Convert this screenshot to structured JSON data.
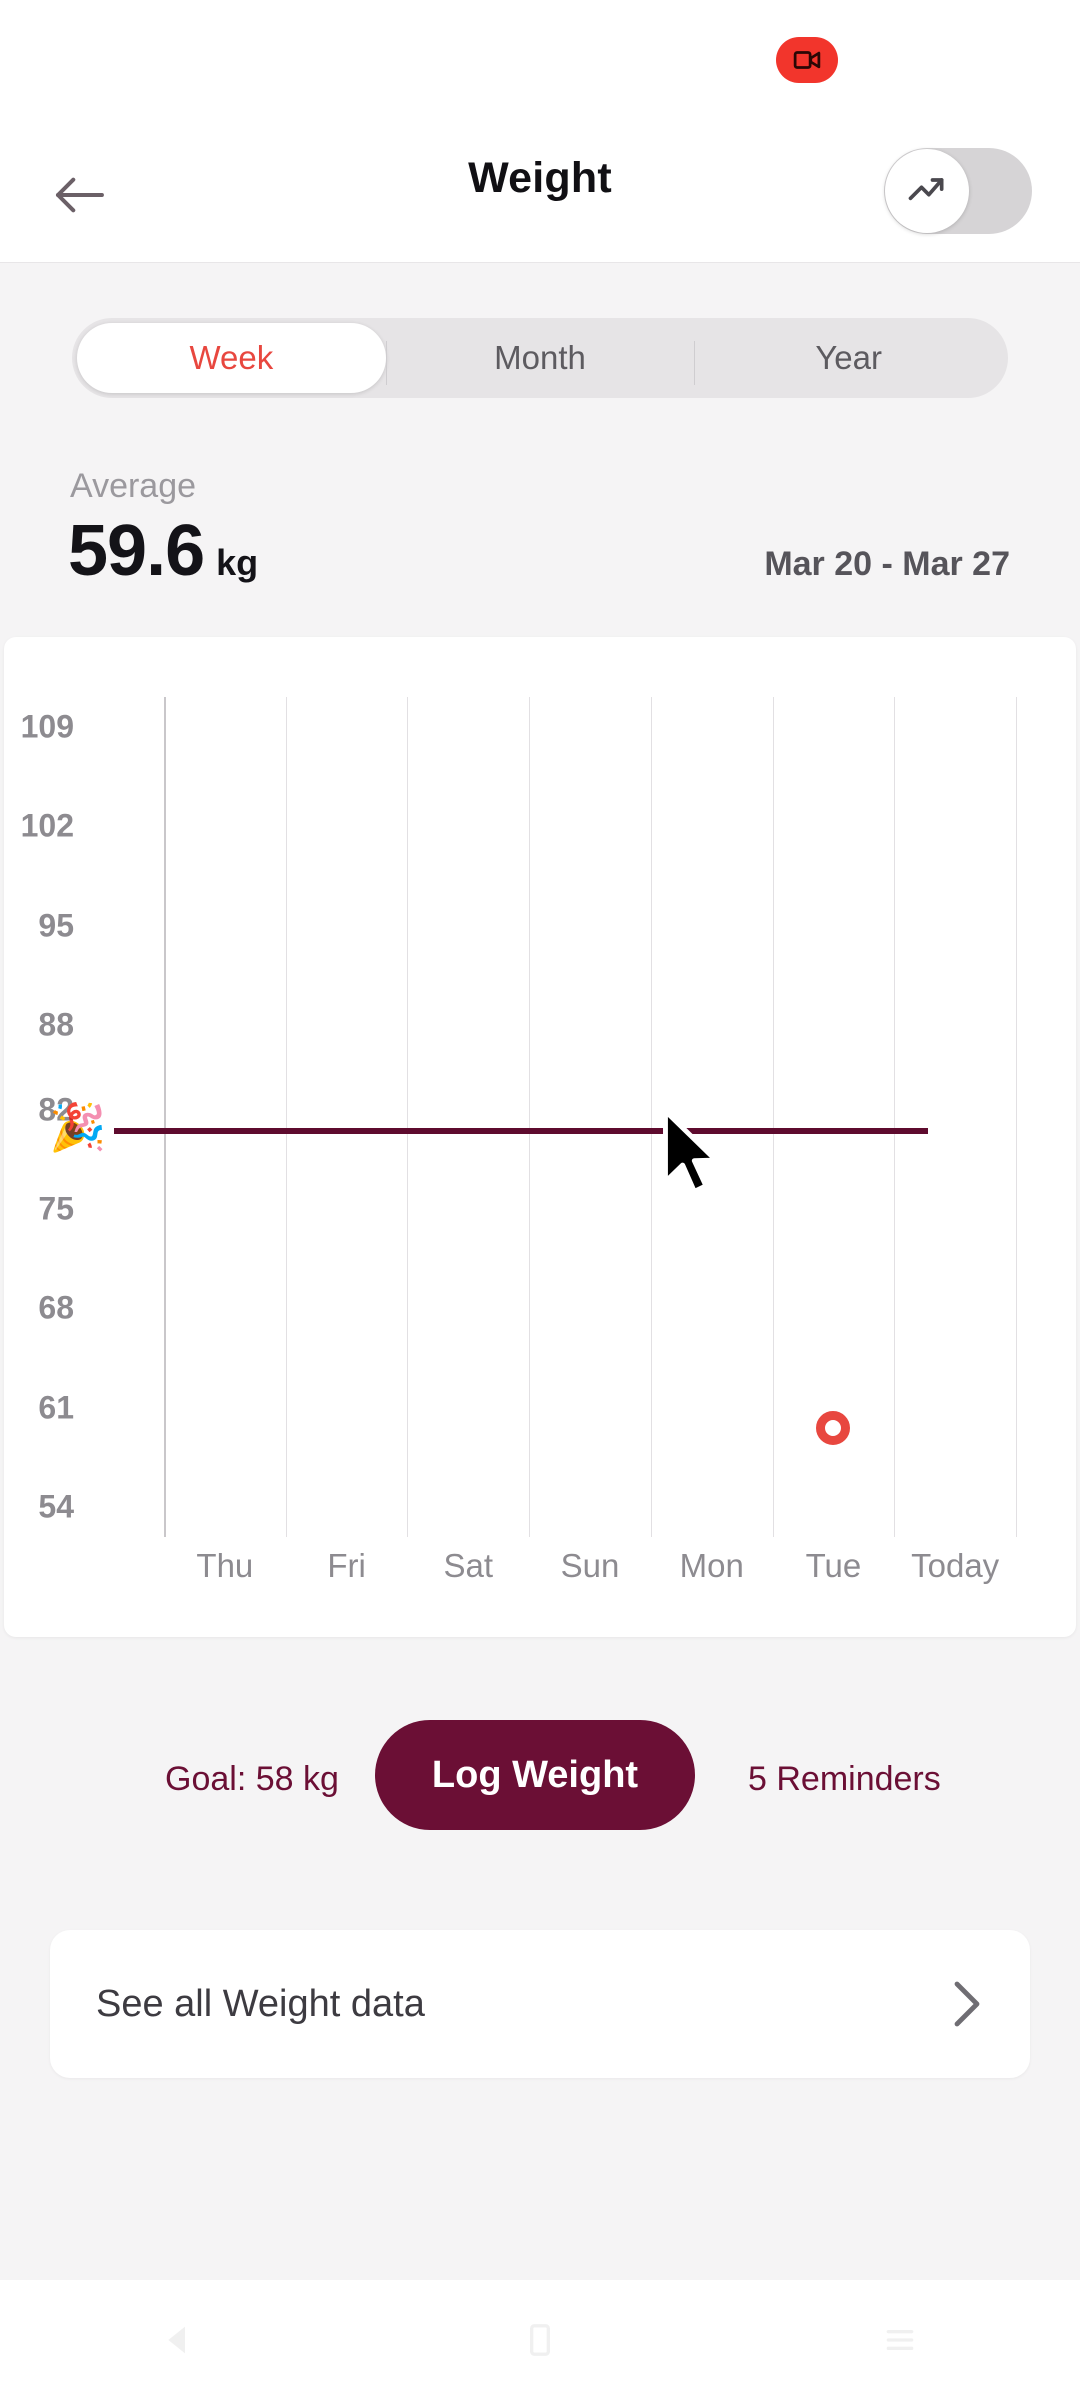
{
  "statusbar": {
    "recording_icon": "video-recording-icon",
    "recording_color": "#f2352c"
  },
  "header": {
    "title": "Weight",
    "back_icon": "arrow-left-icon",
    "toggle_icon": "trending-up-icon",
    "toggle_state": "off"
  },
  "segmented": {
    "options": [
      {
        "label": "Week",
        "active": true
      },
      {
        "label": "Month",
        "active": false
      },
      {
        "label": "Year",
        "active": false
      }
    ],
    "active_color": "#e8473f"
  },
  "summary": {
    "average_label": "Average",
    "average_value": "59.6",
    "average_unit": "kg",
    "date_range": "Mar 20 - Mar 27"
  },
  "chart_data": {
    "type": "scatter",
    "title": "",
    "xlabel": "",
    "ylabel": "",
    "categories": [
      "Thu",
      "Fri",
      "Sat",
      "Sun",
      "Mon",
      "Tue",
      "Today"
    ],
    "yticks": [
      109,
      102,
      95,
      88,
      82,
      75,
      68,
      61,
      54
    ],
    "ylim": [
      54,
      109
    ],
    "grid": true,
    "series": [
      {
        "name": "Weight",
        "color": "#e8473f",
        "points": [
          {
            "x": "Tue",
            "y": 59.6
          }
        ]
      }
    ],
    "annotations": [
      {
        "type": "hline",
        "name": "goal-line",
        "value": 82,
        "color": "#5e0b2e",
        "emoji": "🎉"
      }
    ]
  },
  "actions": {
    "goal_text": "Goal: 58 kg",
    "log_button": "Log Weight",
    "reminders_text": "5 Reminders",
    "accent_color": "#6b0f35"
  },
  "seeall": {
    "label": "See all Weight data",
    "chevron_icon": "chevron-right-icon"
  },
  "navbar": {
    "back_icon": "nav-back-icon",
    "home_icon": "nav-home-icon",
    "recents_icon": "nav-recents-icon"
  },
  "cursor": {
    "icon": "mouse-pointer-icon"
  }
}
